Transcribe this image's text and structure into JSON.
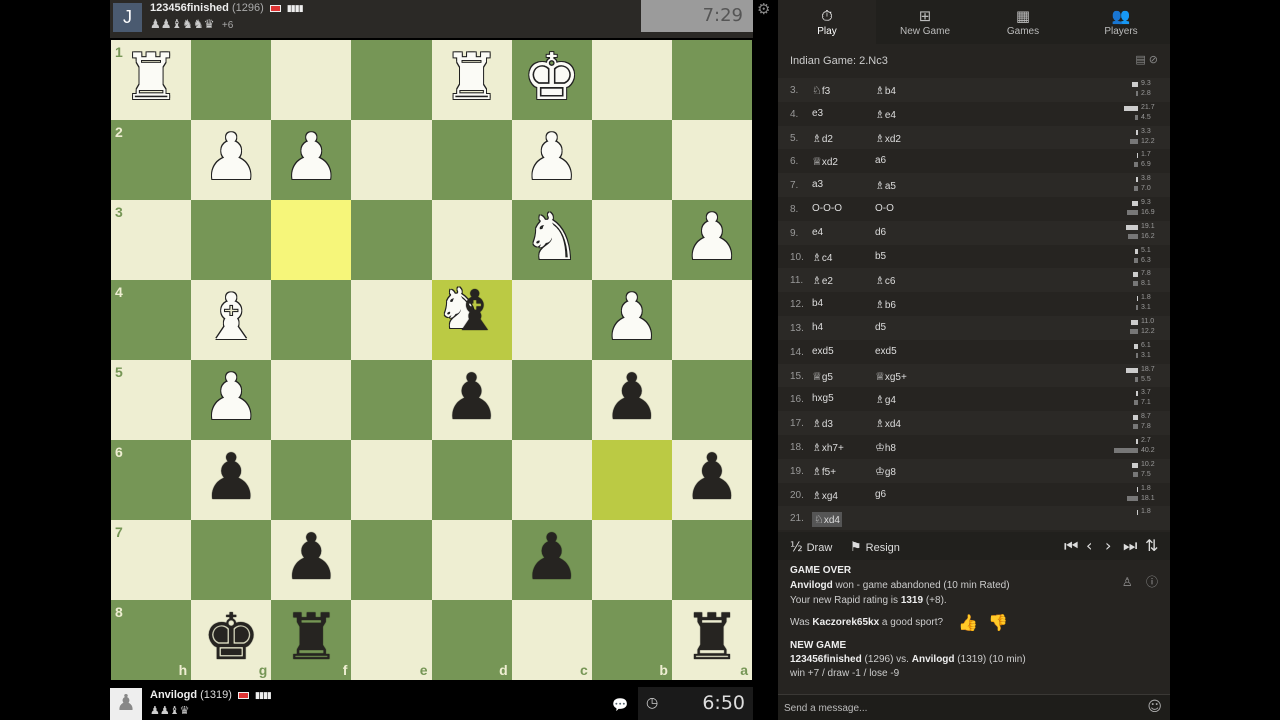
{
  "top_player": {
    "avatar_letter": "J",
    "name": "123456finished",
    "rating": "(1296)",
    "signal": "▮▮▮▮",
    "captured": "♟♟♝♞♞♛",
    "diff": "+6",
    "clock": "7:29"
  },
  "board": [
    [
      {
        "p": "♜",
        "c": "w"
      },
      {
        "p": ""
      },
      {
        "p": ""
      },
      {
        "p": ""
      },
      {
        "p": "♜",
        "c": "w"
      },
      {
        "p": "♚",
        "c": "w"
      },
      {
        "p": ""
      },
      {
        "p": ""
      }
    ],
    [
      {
        "p": ""
      },
      {
        "p": "♟",
        "c": "w"
      },
      {
        "p": "♟",
        "c": "w"
      },
      {
        "p": ""
      },
      {
        "p": ""
      },
      {
        "p": "♟",
        "c": "w"
      },
      {
        "p": ""
      },
      {
        "p": ""
      }
    ],
    [
      {
        "p": ""
      },
      {
        "p": ""
      },
      {
        "p": "",
        "h": "hl"
      },
      {
        "p": ""
      },
      {
        "p": ""
      },
      {
        "p": "♞",
        "c": "w"
      },
      {
        "p": ""
      },
      {
        "p": "♟",
        "c": "w"
      }
    ],
    [
      {
        "p": ""
      },
      {
        "p": "♝",
        "c": "w"
      },
      {
        "p": ""
      },
      {
        "p": ""
      },
      {
        "p": "dual",
        "h": "hd"
      },
      {
        "p": ""
      },
      {
        "p": "♟",
        "c": "w"
      },
      {
        "p": ""
      }
    ],
    [
      {
        "p": ""
      },
      {
        "p": "♟",
        "c": "w"
      },
      {
        "p": ""
      },
      {
        "p": ""
      },
      {
        "p": "♟",
        "c": "b"
      },
      {
        "p": ""
      },
      {
        "p": "♟",
        "c": "b"
      },
      {
        "p": ""
      }
    ],
    [
      {
        "p": ""
      },
      {
        "p": "♟",
        "c": "b"
      },
      {
        "p": ""
      },
      {
        "p": ""
      },
      {
        "p": ""
      },
      {
        "p": ""
      },
      {
        "p": "",
        "h": "hd"
      },
      {
        "p": "♟",
        "c": "b"
      }
    ],
    [
      {
        "p": ""
      },
      {
        "p": ""
      },
      {
        "p": "♟",
        "c": "b"
      },
      {
        "p": ""
      },
      {
        "p": ""
      },
      {
        "p": "♟",
        "c": "b"
      },
      {
        "p": ""
      },
      {
        "p": ""
      }
    ],
    [
      {
        "p": ""
      },
      {
        "p": "♚",
        "c": "b"
      },
      {
        "p": "♜",
        "c": "b"
      },
      {
        "p": ""
      },
      {
        "p": ""
      },
      {
        "p": ""
      },
      {
        "p": ""
      },
      {
        "p": "♜",
        "c": "b"
      }
    ]
  ],
  "ranks": [
    "1",
    "2",
    "3",
    "4",
    "5",
    "6",
    "7",
    "8"
  ],
  "files": [
    "h",
    "g",
    "f",
    "e",
    "d",
    "c",
    "b",
    "a"
  ],
  "bottom_player": {
    "name": "Anvilogd",
    "rating": "(1319)",
    "signal": "▮▮▮▮",
    "captured": "♟♟♝♛",
    "clock": "6:50"
  },
  "tabs": [
    {
      "label": "Play",
      "icon": "⏱",
      "icon_name": "stopwatch-icon"
    },
    {
      "label": "New Game",
      "icon": "⊞",
      "icon_name": "plus-square-icon"
    },
    {
      "label": "Games",
      "icon": "▦",
      "icon_name": "chessboard-icon"
    },
    {
      "label": "Players",
      "icon": "👥",
      "icon_name": "players-icon"
    }
  ],
  "opening": "Indian Game: 2.Nc3",
  "moves": [
    {
      "n": "3.",
      "wf": "♘",
      "w": "f3",
      "bf": "♗",
      "b": "b4",
      "tw": "9.3",
      "tb": "2.8",
      "bw": 6,
      "bb": 2
    },
    {
      "n": "4.",
      "wf": "",
      "w": "e3",
      "bf": "♗",
      "b": "e4",
      "tw": "21.7",
      "tb": "4.5",
      "bw": 14,
      "bb": 3
    },
    {
      "n": "5.",
      "wf": "♗",
      "w": "d2",
      "bf": "♗",
      "b": "xd2",
      "tw": "3.3",
      "tb": "12.2",
      "bw": 2,
      "bb": 8
    },
    {
      "n": "6.",
      "wf": "♕",
      "w": "xd2",
      "bf": "",
      "b": "a6",
      "tw": "1.7",
      "tb": "6.9",
      "bw": 1,
      "bb": 4
    },
    {
      "n": "7.",
      "wf": "",
      "w": "a3",
      "bf": "♗",
      "b": "a5",
      "tw": "3.8",
      "tb": "7.0",
      "bw": 2,
      "bb": 4
    },
    {
      "n": "8.",
      "wf": "",
      "w": "O-O-O",
      "bf": "",
      "b": "O-O",
      "tw": "9.3",
      "tb": "16.9",
      "bw": 6,
      "bb": 11
    },
    {
      "n": "9.",
      "wf": "",
      "w": "e4",
      "bf": "",
      "b": "d6",
      "tw": "19.1",
      "tb": "16.2",
      "bw": 12,
      "bb": 10
    },
    {
      "n": "10.",
      "wf": "♗",
      "w": "c4",
      "bf": "",
      "b": "b5",
      "tw": "5.1",
      "tb": "6.3",
      "bw": 3,
      "bb": 4
    },
    {
      "n": "11.",
      "wf": "♗",
      "w": "e2",
      "bf": "♗",
      "b": "c6",
      "tw": "7.8",
      "tb": "8.1",
      "bw": 5,
      "bb": 5
    },
    {
      "n": "12.",
      "wf": "",
      "w": "b4",
      "bf": "♗",
      "b": "b6",
      "tw": "1.8",
      "tb": "3.1",
      "bw": 1,
      "bb": 2
    },
    {
      "n": "13.",
      "wf": "",
      "w": "h4",
      "bf": "",
      "b": "d5",
      "tw": "11.0",
      "tb": "12.2",
      "bw": 7,
      "bb": 8
    },
    {
      "n": "14.",
      "wf": "",
      "w": "exd5",
      "bf": "",
      "b": "exd5",
      "tw": "6.1",
      "tb": "3.1",
      "bw": 4,
      "bb": 2
    },
    {
      "n": "15.",
      "wf": "♕",
      "w": "g5",
      "bf": "♕",
      "b": "xg5+",
      "tw": "18.7",
      "tb": "5.5",
      "bw": 12,
      "bb": 3
    },
    {
      "n": "16.",
      "wf": "",
      "w": "hxg5",
      "bf": "♗",
      "b": "g4",
      "tw": "3.7",
      "tb": "7.1",
      "bw": 2,
      "bb": 4
    },
    {
      "n": "17.",
      "wf": "♗",
      "w": "d3",
      "bf": "♗",
      "b": "xd4",
      "tw": "8.7",
      "tb": "7.8",
      "bw": 5,
      "bb": 5
    },
    {
      "n": "18.",
      "wf": "♗",
      "w": "xh7+",
      "bf": "♔",
      "b": "h8",
      "tw": "2.7",
      "tb": "40.2",
      "bw": 2,
      "bb": 24
    },
    {
      "n": "19.",
      "wf": "♗",
      "w": "f5+",
      "bf": "♔",
      "b": "g8",
      "tw": "10.2",
      "tb": "7.5",
      "bw": 6,
      "bb": 5
    },
    {
      "n": "20.",
      "wf": "♗",
      "w": "xg4",
      "bf": "",
      "b": "g6",
      "tw": "1.8",
      "tb": "18.1",
      "bw": 1,
      "bb": 11
    },
    {
      "n": "21.",
      "wf": "♘",
      "w": "xd4",
      "bf": "",
      "b": "",
      "tw": "1.8",
      "tb": "",
      "bw": 1,
      "bb": 0,
      "cur": true
    }
  ],
  "controls": {
    "draw": "Draw",
    "draw_icon": "½",
    "resign": "Resign",
    "resign_icon": "⚑"
  },
  "nav": {
    "first": "⏮",
    "prev": "‹",
    "next": "›",
    "last": "⏭",
    "flip": "⇅"
  },
  "game_over": {
    "title": "GAME OVER",
    "winner": "Anvilogd",
    "result": " won - game abandoned (10 min Rated)",
    "rating_pre": "Your new Rapid rating is ",
    "rating": "1319",
    "rating_post": " (+8)."
  },
  "sport": {
    "pre": "Was ",
    "name": "Kaczorek65kx",
    "post": " a good sport?",
    "up": "👍",
    "down": "👎"
  },
  "new_game": {
    "title": "NEW GAME",
    "p1": "123456finished",
    "p1_rating": " (1296) vs. ",
    "p2": "Anvilogd",
    "p2_rating": " (1319) (10 min)",
    "stats": "win +7 / draw -1 / lose -9"
  },
  "message_placeholder": "Send a message..."
}
